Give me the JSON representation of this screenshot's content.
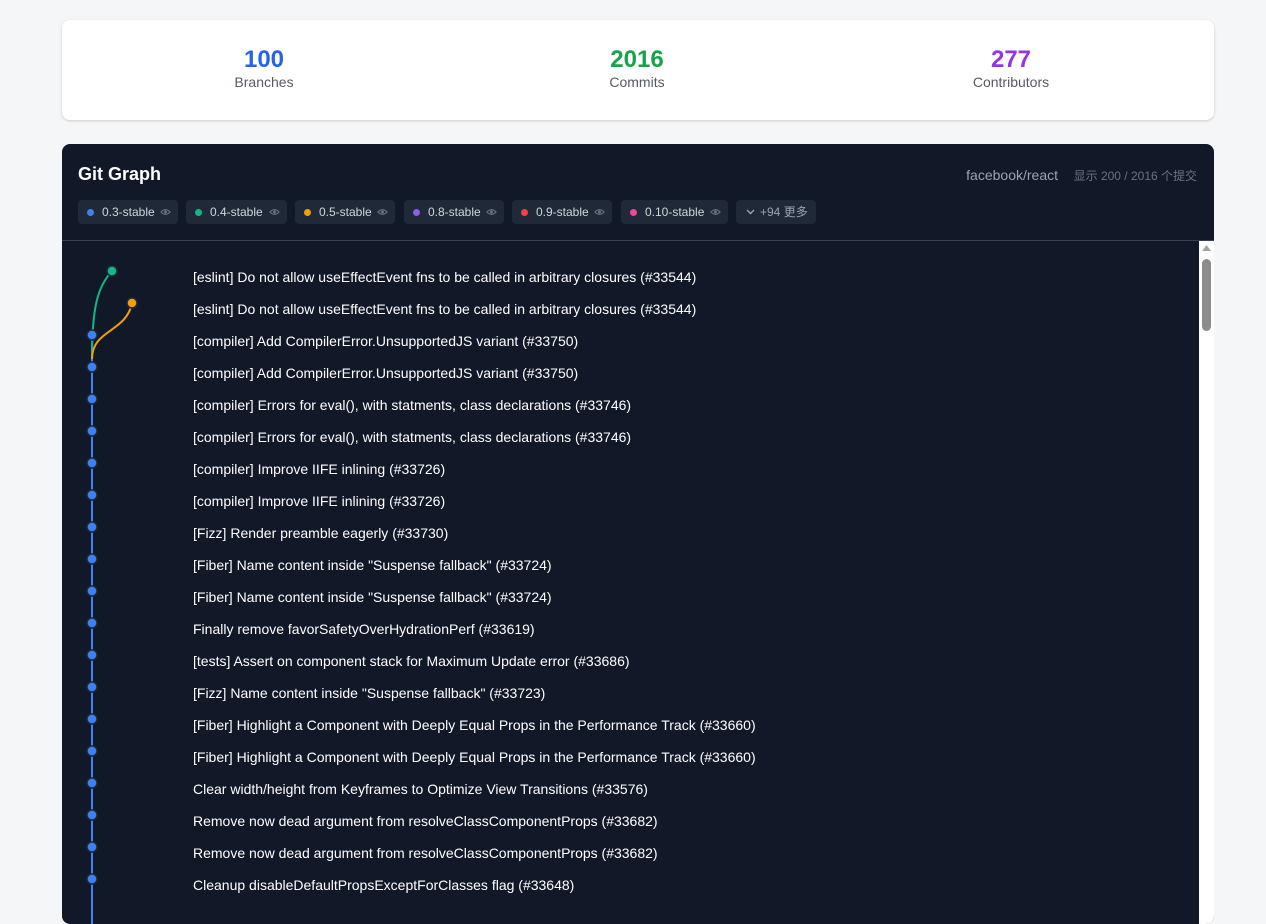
{
  "stats": [
    {
      "value": "100",
      "label": "Branches",
      "color": "#2563eb"
    },
    {
      "value": "2016",
      "label": "Commits",
      "color": "#16a34a"
    },
    {
      "value": "277",
      "label": "Contributors",
      "color": "#9333ea"
    }
  ],
  "panel": {
    "title": "Git Graph",
    "repo": "facebook/react",
    "showing": "显示 200 / 2016 个提交"
  },
  "branches": [
    {
      "name": "0.3-stable",
      "color": "#3b82f6",
      "icon": "eye-icon"
    },
    {
      "name": "0.4-stable",
      "color": "#10b981",
      "icon": "eye-icon"
    },
    {
      "name": "0.5-stable",
      "color": "#f59e0b",
      "icon": "eye-icon"
    },
    {
      "name": "0.8-stable",
      "color": "#8b5cf6",
      "icon": "eye-icon"
    },
    {
      "name": "0.9-stable",
      "color": "#ef4444",
      "icon": "eye-icon"
    },
    {
      "name": "0.10-stable",
      "color": "#ec4899",
      "icon": "eye-icon"
    }
  ],
  "more_branches": {
    "label": "+94 更多",
    "icon": "chevron-down-icon"
  },
  "commits": [
    {
      "message": "[eslint] Do not allow useEffectEvent fns to be called in arbitrary closures (#33544)",
      "lane": "green"
    },
    {
      "message": "[eslint] Do not allow useEffectEvent fns to be called in arbitrary closures (#33544)",
      "lane": "orange"
    },
    {
      "message": "[compiler] Add CompilerError.UnsupportedJS variant (#33750)",
      "lane": "blue"
    },
    {
      "message": "[compiler] Add CompilerError.UnsupportedJS variant (#33750)",
      "lane": "blue"
    },
    {
      "message": "[compiler] Errors for eval(), with statments, class declarations (#33746)",
      "lane": "blue"
    },
    {
      "message": "[compiler] Errors for eval(), with statments, class declarations (#33746)",
      "lane": "blue"
    },
    {
      "message": "[compiler] Improve IIFE inlining (#33726)",
      "lane": "blue"
    },
    {
      "message": "[compiler] Improve IIFE inlining (#33726)",
      "lane": "blue"
    },
    {
      "message": "[Fizz] Render preamble eagerly (#33730)",
      "lane": "blue"
    },
    {
      "message": "[Fiber] Name content inside \"Suspense fallback\" (#33724)",
      "lane": "blue"
    },
    {
      "message": "[Fiber] Name content inside \"Suspense fallback\" (#33724)",
      "lane": "blue"
    },
    {
      "message": "Finally remove favorSafetyOverHydrationPerf (#33619)",
      "lane": "blue"
    },
    {
      "message": "[tests] Assert on component stack for Maximum Update error (#33686)",
      "lane": "blue"
    },
    {
      "message": "[Fizz] Name content inside \"Suspense fallback\" (#33723)",
      "lane": "blue"
    },
    {
      "message": "[Fiber] Highlight a Component with Deeply Equal Props in the Performance Track (#33660)",
      "lane": "blue"
    },
    {
      "message": "[Fiber] Highlight a Component with Deeply Equal Props in the Performance Track (#33660)",
      "lane": "blue"
    },
    {
      "message": "Clear width/height from Keyframes to Optimize View Transitions (#33576)",
      "lane": "blue"
    },
    {
      "message": "Remove now dead argument from resolveClassComponentProps (#33682)",
      "lane": "blue"
    },
    {
      "message": "Remove now dead argument from resolveClassComponentProps (#33682)",
      "lane": "blue"
    },
    {
      "message": "Cleanup disableDefaultPropsExceptForClasses flag (#33648)",
      "lane": "blue"
    }
  ],
  "lane_colors": {
    "blue": "#3b82f6",
    "green": "#10b981",
    "orange": "#f59e0b"
  }
}
